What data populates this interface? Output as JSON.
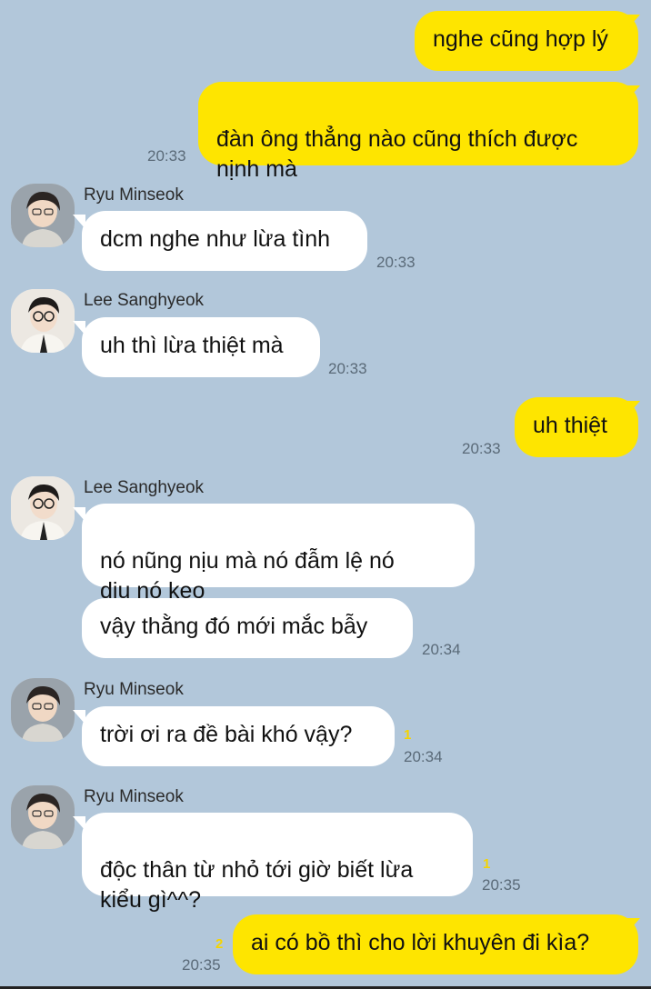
{
  "colors": {
    "background": "#b2c7da",
    "my_bubble": "#fee500",
    "their_bubble": "#ffffff",
    "unread": "#f5d400"
  },
  "messages": [
    {
      "text": "nghe cũng hợp lý"
    },
    {
      "text": "đàn ông thẳng nào cũng thích được\nnịnh mà",
      "time": "20:33"
    },
    {
      "sender": "Ryu Minseok",
      "avatar": "avatar-icon",
      "text": "dcm nghe như lừa tình",
      "time": "20:33"
    },
    {
      "sender": "Lee Sanghyeok",
      "avatar": "avatar-icon",
      "text": "uh thì lừa thiệt mà",
      "time": "20:33"
    },
    {
      "text": "uh thiệt",
      "time": "20:33"
    },
    {
      "sender": "Lee Sanghyeok",
      "avatar": "avatar-icon",
      "text": "nó nũng nịu mà nó đẫm lệ nó\ndịu nó keo"
    },
    {
      "text": "vậy thằng đó mới mắc bẫy",
      "time": "20:34"
    },
    {
      "sender": "Ryu Minseok",
      "avatar": "avatar-icon",
      "text": "trời ơi ra đề bài khó vậy?",
      "unread": "1",
      "time": "20:34"
    },
    {
      "sender": "Ryu Minseok",
      "avatar": "avatar-icon",
      "text": "độc thân từ nhỏ tới giờ biết lừa\nkiểu gì^^?",
      "unread": "1",
      "time": "20:35"
    },
    {
      "text": "ai có bồ thì cho lời khuyên đi kìa?",
      "unread": "2",
      "time": "20:35"
    }
  ]
}
